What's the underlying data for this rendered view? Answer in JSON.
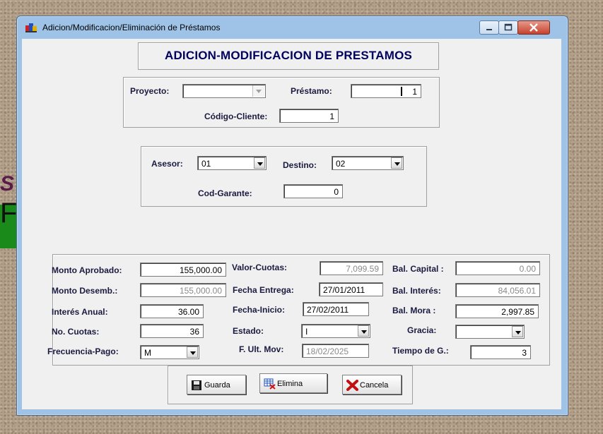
{
  "window": {
    "title": "Adicion/Modificacion/Eliminación de Préstamos"
  },
  "header": {
    "title": "ADICION-MODIFICACION DE PRESTAMOS"
  },
  "section1": {
    "proyecto_label": "Proyecto:",
    "proyecto_value": "",
    "prestamo_label": "Préstamo:",
    "prestamo_value": "1",
    "codigo_cliente_label": "Código-Cliente:",
    "codigo_cliente_value": "1"
  },
  "section2": {
    "asesor_label": "Asesor:",
    "asesor_value": "01",
    "destino_label": "Destino:",
    "destino_value": "02",
    "cod_garante_label": "Cod-Garante:",
    "cod_garante_value": "0"
  },
  "section3": {
    "monto_aprobado_label": "Monto Aprobado:",
    "monto_aprobado_value": "155,000.00",
    "monto_desemb_label": "Monto Desemb.:",
    "monto_desemb_value": "155,000.00",
    "interes_anual_label": "Interés Anual:",
    "interes_anual_value": "36.00",
    "no_cuotas_label": "No. Cuotas:",
    "no_cuotas_value": "36",
    "frecuencia_label": "Frecuencia-Pago:",
    "frecuencia_value": "M",
    "valor_cuotas_label": "Valor-Cuotas:",
    "valor_cuotas_value": "7,099.59",
    "fecha_entrega_label": "Fecha Entrega:",
    "fecha_entrega_value": "27/01/2011",
    "fecha_inicio_label": "Fecha-Inicio:",
    "fecha_inicio_value": "27/02/2011",
    "estado_label": "Estado:",
    "estado_value": "I",
    "ult_mov_label": "F. Ult. Mov:",
    "ult_mov_value": "18/02/2025",
    "bal_capital_label": "Bal. Capital :",
    "bal_capital_value": "0.00",
    "bal_interes_label": "Bal. Interés:",
    "bal_interes_value": "84,056.01",
    "bal_mora_label": "Bal. Mora  :",
    "bal_mora_value": "2,997.85",
    "gracia_label": "Gracia:",
    "gracia_value": "",
    "tiempo_label": "Tiempo de G.:",
    "tiempo_value": "3"
  },
  "buttons": {
    "guarda": "Guarda",
    "elimina": "Elimina",
    "cancela": "Cancela"
  },
  "background": {
    "fragment_s": "S",
    "fragment_f": "F"
  }
}
